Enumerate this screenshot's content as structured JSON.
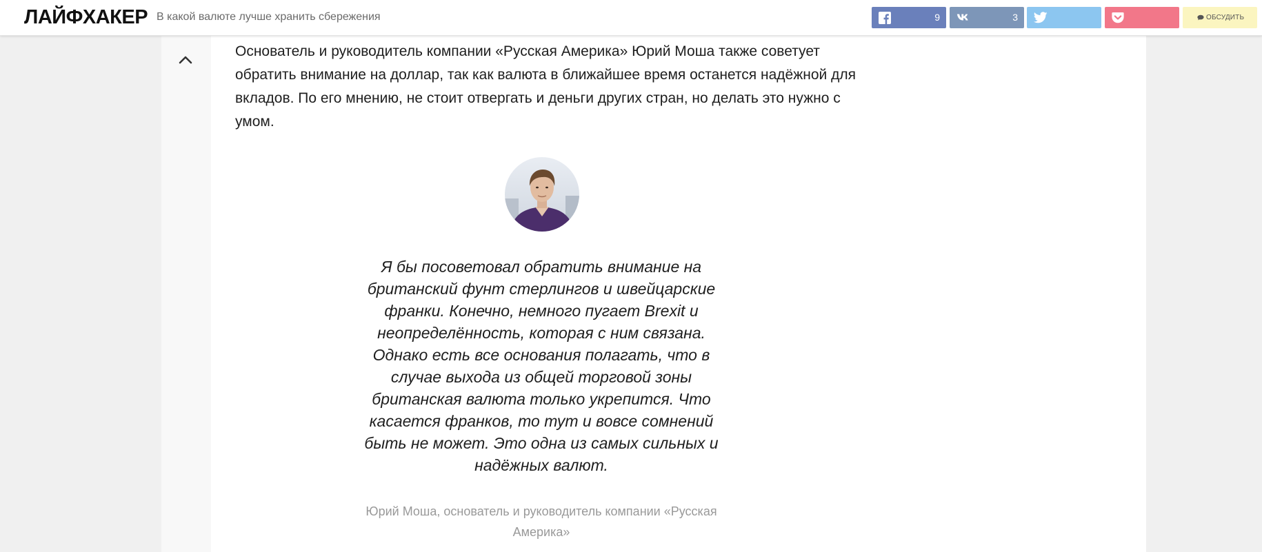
{
  "header": {
    "logo": "ЛАЙФХАКЕР",
    "headline": "В какой валюте лучше хранить сбережения",
    "share": [
      {
        "icon": "facebook-icon",
        "count": "9",
        "color": "#6a80bb"
      },
      {
        "icon": "vk-icon",
        "count": "3",
        "color": "#7d96b8"
      },
      {
        "icon": "twitter-icon",
        "count": "",
        "color": "#8cc6f0"
      },
      {
        "icon": "pocket-icon",
        "count": "",
        "color": "#f27789"
      }
    ],
    "discuss_label": "ОБСУДИТЬ"
  },
  "article": {
    "paragraph": "Основатель и руководитель компании «Русская Америка» Юрий Моша также советует обратить внимание на доллар, так как валюта в ближайшее время останется надёжной для вкладов. По его мнению, не стоит отвергать и деньги других стран, но делать это нужно с умом.",
    "quote": "Я бы посоветовал обратить внимание на британский фунт стерлингов и швейцарские франки. Конечно, немного пугает Brexit и неопределённость, которая с ним связана. Однако есть все основания полагать, что в случае выхода из общей торговой зоны британская валюта только укрепится. Что касается франков, то тут и вовсе сомнений быть не может. Это одна из самых сильных и надёжных валют.",
    "quote_author": "Юрий Моша, основатель и руководитель компании «Русская Америка»"
  }
}
